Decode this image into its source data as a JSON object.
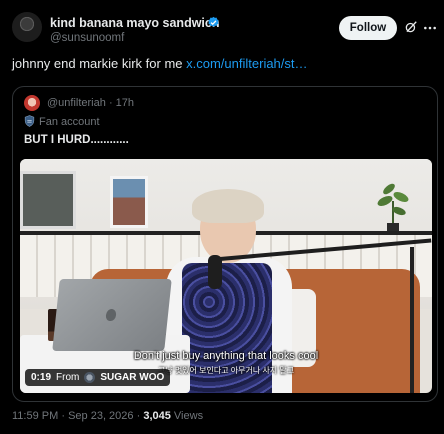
{
  "post": {
    "display_name": "kind banana mayo sandwich",
    "handle": "@sunsunoomf",
    "follow_label": "Follow",
    "text": "johnny end markie kirk for me",
    "link_text": "x.com/unfilteriah/st…",
    "icons": {
      "verified": "verified-badge-icon",
      "grok": "grok-icon",
      "more": "more-icon"
    }
  },
  "quote": {
    "handle": "@unfilteriah",
    "separator": "·",
    "time": "17h",
    "label": "Fan account",
    "label_icon": "shield-icon",
    "text": "BUT I HURD............"
  },
  "video": {
    "subtitle_en": "Don't just buy anything that looks cool",
    "subtitle_ko": "그냥 멋있어 보인다고 아무거나 사지 말고",
    "duration": "0:19",
    "from_label": "From",
    "source_name": "SUGAR WOO"
  },
  "meta": {
    "time": "11:59 PM",
    "separator": "·",
    "date": "Sep 23, 2026",
    "views_count": "3,045",
    "views_label": "Views"
  },
  "colors": {
    "background": "#000000",
    "text_primary": "#e7e9ea",
    "text_secondary": "#71767b",
    "link": "#1d9bf0",
    "verified": "#1d9bf0",
    "follow_bg": "#eff3f4",
    "border": "#2f3336"
  }
}
